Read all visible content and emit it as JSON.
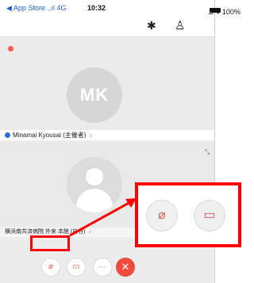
{
  "status_bar": {
    "back_label": "◀ App Store ..ıl 4G",
    "time": "10:32",
    "battery": "⊿ ♥ 100%"
  },
  "top_bar": {
    "bluetooth_icon": "bluetooth-icon",
    "participants_icon": "person-icon"
  },
  "participants": [
    {
      "initials": "MK",
      "name": "Minamai Kyousai (主催者)"
    },
    {
      "name": "横浜南共済病院 外来 本館 (自分)"
    }
  ],
  "toolbar": {
    "mic_icon": "mic-muted-icon",
    "camera_icon": "camera-off-icon",
    "more_label": "···",
    "end_label": "✕"
  },
  "annotation": {
    "color": "#ff0000"
  }
}
